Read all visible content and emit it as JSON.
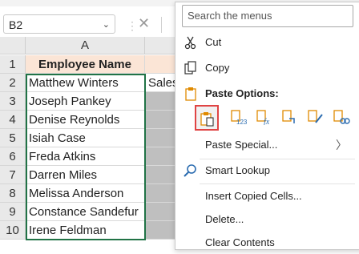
{
  "name_box": {
    "value": "B2"
  },
  "grid": {
    "columns": [
      "A"
    ],
    "rows": [
      {
        "n": "1",
        "a": "Employee Name",
        "b": ""
      },
      {
        "n": "2",
        "a": "Matthew Winters",
        "b": "Sales"
      },
      {
        "n": "3",
        "a": "Joseph Pankey",
        "b": ""
      },
      {
        "n": "4",
        "a": "Denise Reynolds",
        "b": ""
      },
      {
        "n": "5",
        "a": "Isiah Case",
        "b": ""
      },
      {
        "n": "6",
        "a": "Freda Atkins",
        "b": ""
      },
      {
        "n": "7",
        "a": "Darren Miles",
        "b": ""
      },
      {
        "n": "8",
        "a": "Melissa Anderson",
        "b": ""
      },
      {
        "n": "9",
        "a": "Constance Sandefur",
        "b": ""
      },
      {
        "n": "10",
        "a": "Irene Feldman",
        "b": ""
      }
    ]
  },
  "context_menu": {
    "search_placeholder": "Search the menus",
    "cut": "Cut",
    "copy": "Copy",
    "paste_options": "Paste Options:",
    "paste_special": "Paste Special...",
    "smart_lookup": "Smart Lookup",
    "insert_copied_cells": "Insert Copied Cells...",
    "delete": "Delete...",
    "clear_contents": "Clear Contents"
  },
  "colors": {
    "accent_green": "#217346",
    "header_fill": "#fbe5d6",
    "paste_highlight": "#e04444",
    "icon_blue": "#2b6cb0",
    "icon_orange": "#e08a00"
  }
}
